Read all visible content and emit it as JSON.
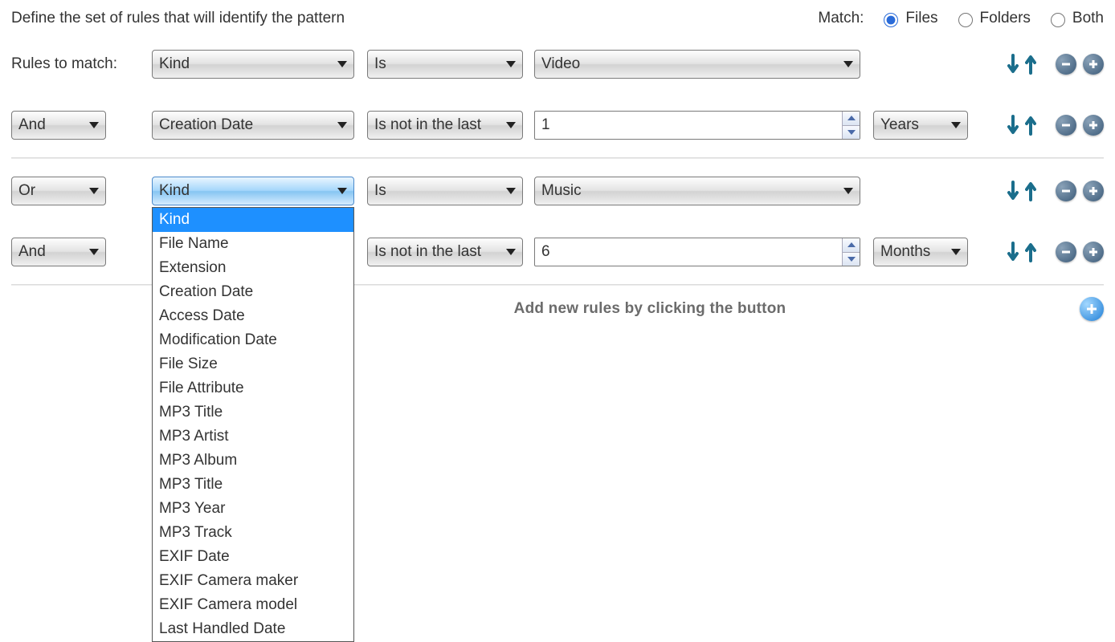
{
  "header": {
    "title": "Define the set of rules that will identify the pattern",
    "match_label": "Match:",
    "radios": {
      "files": "Files",
      "folders": "Folders",
      "both": "Both"
    },
    "selected": "files"
  },
  "labels": {
    "rules_to_match": "Rules to match:"
  },
  "rules": [
    {
      "logic": null,
      "property": "Kind",
      "operator": "Is",
      "value_type": "combo",
      "value": "Video",
      "unit": null
    },
    {
      "logic": "And",
      "property": "Creation Date",
      "operator": "Is not in the last",
      "value_type": "number",
      "value": "1",
      "unit": "Years"
    },
    {
      "logic": "Or",
      "property": "Kind",
      "operator": "Is",
      "value_type": "combo",
      "value": "Music",
      "unit": null,
      "dropdown_open": true
    },
    {
      "logic": "And",
      "property": "",
      "operator": "Is not in the last",
      "value_type": "number",
      "value": "6",
      "unit": "Months"
    }
  ],
  "property_options": [
    "Kind",
    "File Name",
    "Extension",
    "Creation Date",
    "Access Date",
    "Modification Date",
    "File Size",
    "File Attribute",
    "MP3 Title",
    "MP3 Artist",
    "MP3 Album",
    "MP3 Title",
    "MP3 Year",
    "MP3 Track",
    "EXIF Date",
    "EXIF Camera maker",
    "EXIF Camera model",
    "Last Handled Date"
  ],
  "hint": "Add new rules by clicking the button"
}
